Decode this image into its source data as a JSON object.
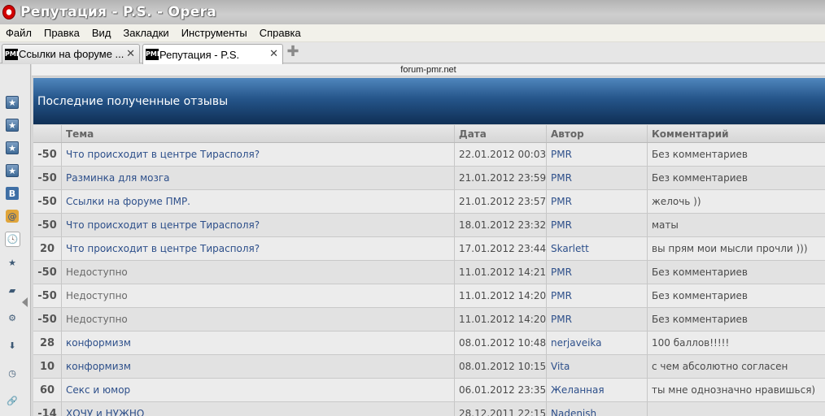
{
  "window": {
    "title": "Репутация - P.S. - Opera"
  },
  "menu": [
    "Файл",
    "Правка",
    "Вид",
    "Закладки",
    "Инструменты",
    "Справка"
  ],
  "tabs": [
    {
      "label": "Ссылки на форуме ...",
      "favicon": "PMR"
    },
    {
      "label": "Репутация - P.S.",
      "favicon": "PMR"
    }
  ],
  "address": {
    "host": "forum-pmr.net"
  },
  "page": {
    "title": "Последние полученные отзывы"
  },
  "table": {
    "headers": [
      "Тема",
      "Дата",
      "Автор",
      "Комментарий"
    ],
    "rows": [
      {
        "rating": "-50",
        "topic": "Что происходит в центре Тирасполя?",
        "date": "22.01.2012 00:03",
        "author": "PMR",
        "comment": "Без комментариев",
        "available": true
      },
      {
        "rating": "-50",
        "topic": "Разминка для мозга",
        "date": "21.01.2012 23:59",
        "author": "PMR",
        "comment": "Без комментариев",
        "available": true
      },
      {
        "rating": "-50",
        "topic": "Ссылки на форуме ПМР.",
        "date": "21.01.2012 23:57",
        "author": "PMR",
        "comment": "желочь ))",
        "available": true
      },
      {
        "rating": "-50",
        "topic": "Что происходит в центре Тирасполя?",
        "date": "18.01.2012 23:32",
        "author": "PMR",
        "comment": "маты",
        "available": true
      },
      {
        "rating": "20",
        "topic": "Что происходит в центре Тирасполя?",
        "date": "17.01.2012 23:44",
        "author": "Skarlett",
        "comment": "вы прям мои мысли прочли )))",
        "available": true
      },
      {
        "rating": "-50",
        "topic": "Недоступно",
        "date": "11.01.2012 14:21",
        "author": "PMR",
        "comment": "Без комментариев",
        "available": false
      },
      {
        "rating": "-50",
        "topic": "Недоступно",
        "date": "11.01.2012 14:20",
        "author": "PMR",
        "comment": "Без комментариев",
        "available": false
      },
      {
        "rating": "-50",
        "topic": "Недоступно",
        "date": "11.01.2012 14:20",
        "author": "PMR",
        "comment": "Без комментариев",
        "available": false
      },
      {
        "rating": "28",
        "topic": "конформизм",
        "date": "08.01.2012 10:48",
        "author": "nerjaveika",
        "comment": "100 баллов!!!!!",
        "available": true
      },
      {
        "rating": "10",
        "topic": "конформизм",
        "date": "08.01.2012 10:15",
        "author": "Vita",
        "comment": "с чем абсолютно согласен",
        "available": true
      },
      {
        "rating": "60",
        "topic": "Секс и юмор",
        "date": "06.01.2012 23:35",
        "author": "Желанная",
        "comment": "ты мне однозначно нравишься)",
        "available": true
      },
      {
        "rating": "-14",
        "topic": "ХОЧУ и НУЖНО",
        "date": "28.12.2011 22:15",
        "author": "Nadenish",
        "comment": "",
        "available": true
      }
    ]
  },
  "panel": {
    "icons": [
      "bookmark-icon",
      "bookmark-icon",
      "bookmark-icon",
      "bookmark-icon",
      "vk-icon",
      "mail-icon",
      "clock-history-icon",
      "star-icon",
      "note-icon",
      "gear-icon",
      "download-icon",
      "clock-icon",
      "link-icon"
    ]
  }
}
